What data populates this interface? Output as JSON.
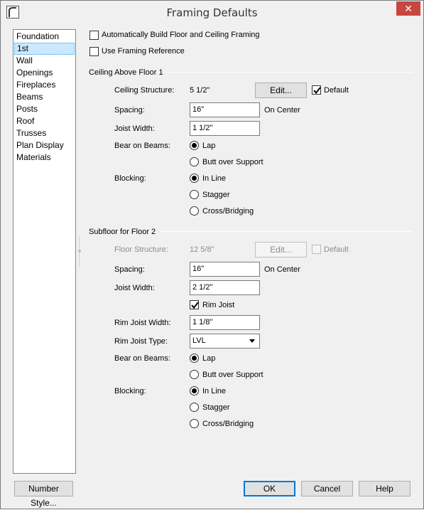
{
  "window": {
    "title": "Framing Defaults",
    "close_glyph": "✕"
  },
  "sidebar": {
    "items": [
      {
        "label": "Foundation"
      },
      {
        "label": "1st",
        "selected": true
      },
      {
        "label": "Wall"
      },
      {
        "label": "Openings"
      },
      {
        "label": "Fireplaces"
      },
      {
        "label": "Beams"
      },
      {
        "label": "Posts"
      },
      {
        "label": "Roof"
      },
      {
        "label": "Trusses"
      },
      {
        "label": "Plan Display"
      },
      {
        "label": "Materials"
      }
    ]
  },
  "options": {
    "auto_build": {
      "label": "Automatically Build Floor and Ceiling Framing",
      "checked": false
    },
    "use_ref": {
      "label": "Use Framing Reference",
      "checked": false
    }
  },
  "ceiling": {
    "title": "Ceiling Above Floor 1",
    "structure_label": "Ceiling Structure:",
    "structure_value": "5 1/2\"",
    "edit_label": "Edit...",
    "default_label": "Default",
    "default_checked": true,
    "spacing_label": "Spacing:",
    "spacing_value": "16\"",
    "on_center": "On Center",
    "joist_width_label": "Joist Width:",
    "joist_width_value": "1 1/2\"",
    "bear_label": "Bear on Beams:",
    "bear_options": [
      "Lap",
      "Butt over Support"
    ],
    "bear_selected": "Lap",
    "blocking_label": "Blocking:",
    "blocking_options": [
      "In Line",
      "Stagger",
      "Cross/Bridging"
    ],
    "blocking_selected": "In Line"
  },
  "subfloor": {
    "title": "Subfloor for Floor 2",
    "structure_label": "Floor Structure:",
    "structure_value": "12 5/8\"",
    "edit_label": "Edit...",
    "default_label": "Default",
    "default_checked": false,
    "spacing_label": "Spacing:",
    "spacing_value": "16\"",
    "on_center": "On Center",
    "joist_width_label": "Joist Width:",
    "joist_width_value": "2 1/2\"",
    "rim_joist_label": "Rim Joist",
    "rim_joist_checked": true,
    "rim_width_label": "Rim Joist Width:",
    "rim_width_value": "1 1/8\"",
    "rim_type_label": "Rim Joist Type:",
    "rim_type_value": "LVL",
    "bear_label": "Bear on Beams:",
    "bear_options": [
      "Lap",
      "Butt over Support"
    ],
    "bear_selected": "Lap",
    "blocking_label": "Blocking:",
    "blocking_options": [
      "In Line",
      "Stagger",
      "Cross/Bridging"
    ],
    "blocking_selected": "In Line"
  },
  "footer": {
    "number_style": "Number Style...",
    "ok": "OK",
    "cancel": "Cancel",
    "help": "Help"
  },
  "colors": {
    "close_button": "#c7463e",
    "selection": "#cce8ff",
    "default_button_border": "#0078d7"
  }
}
